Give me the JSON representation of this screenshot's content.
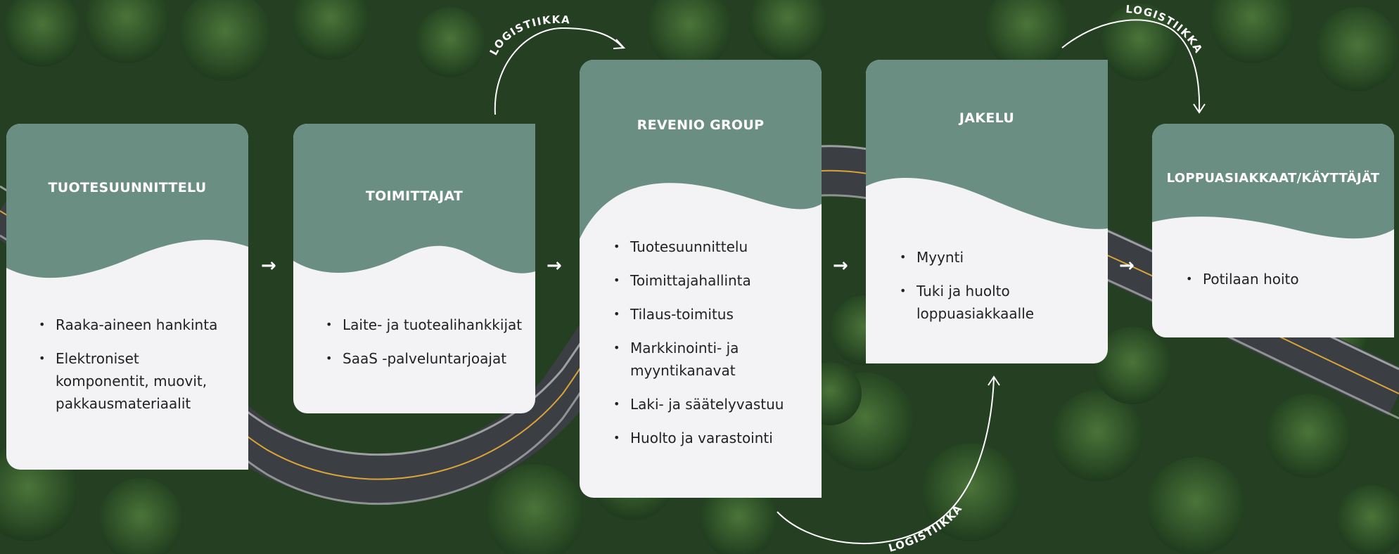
{
  "stages": [
    {
      "title": "TUOTESUUNNITTELU",
      "items": [
        "Raaka-aineen hankinta",
        "Elektroniset komponentit, muovit, pakkausmateriaalit"
      ]
    },
    {
      "title": "TOIMITTAJAT",
      "items": [
        "Laite- ja tuotealihankkijat",
        "SaaS -palveluntarjoajat"
      ]
    },
    {
      "title": "REVENIO GROUP",
      "items": [
        "Tuotesuunnittelu",
        "Toimittajahallinta",
        "Tilaus-toimitus",
        "Markkinointi- ja myyntikanavat",
        "Laki- ja säätelyvastuu",
        "Huolto ja varastointi"
      ]
    },
    {
      "title": "JAKELU",
      "items": [
        "Myynti",
        "Tuki ja huolto loppuasiakkaalle"
      ]
    },
    {
      "title": "LOPPUASIAKKAAT/KÄYTTÄJÄT",
      "items": [
        "Potilaan hoito"
      ]
    }
  ],
  "logistics_label": "LOGISTIIKKA",
  "flow_arrow": "→",
  "colors": {
    "card_header": "#6a8f82",
    "card_body": "#f3f3f5",
    "forest": "#2a4a2b",
    "road": "#3b3f44"
  }
}
